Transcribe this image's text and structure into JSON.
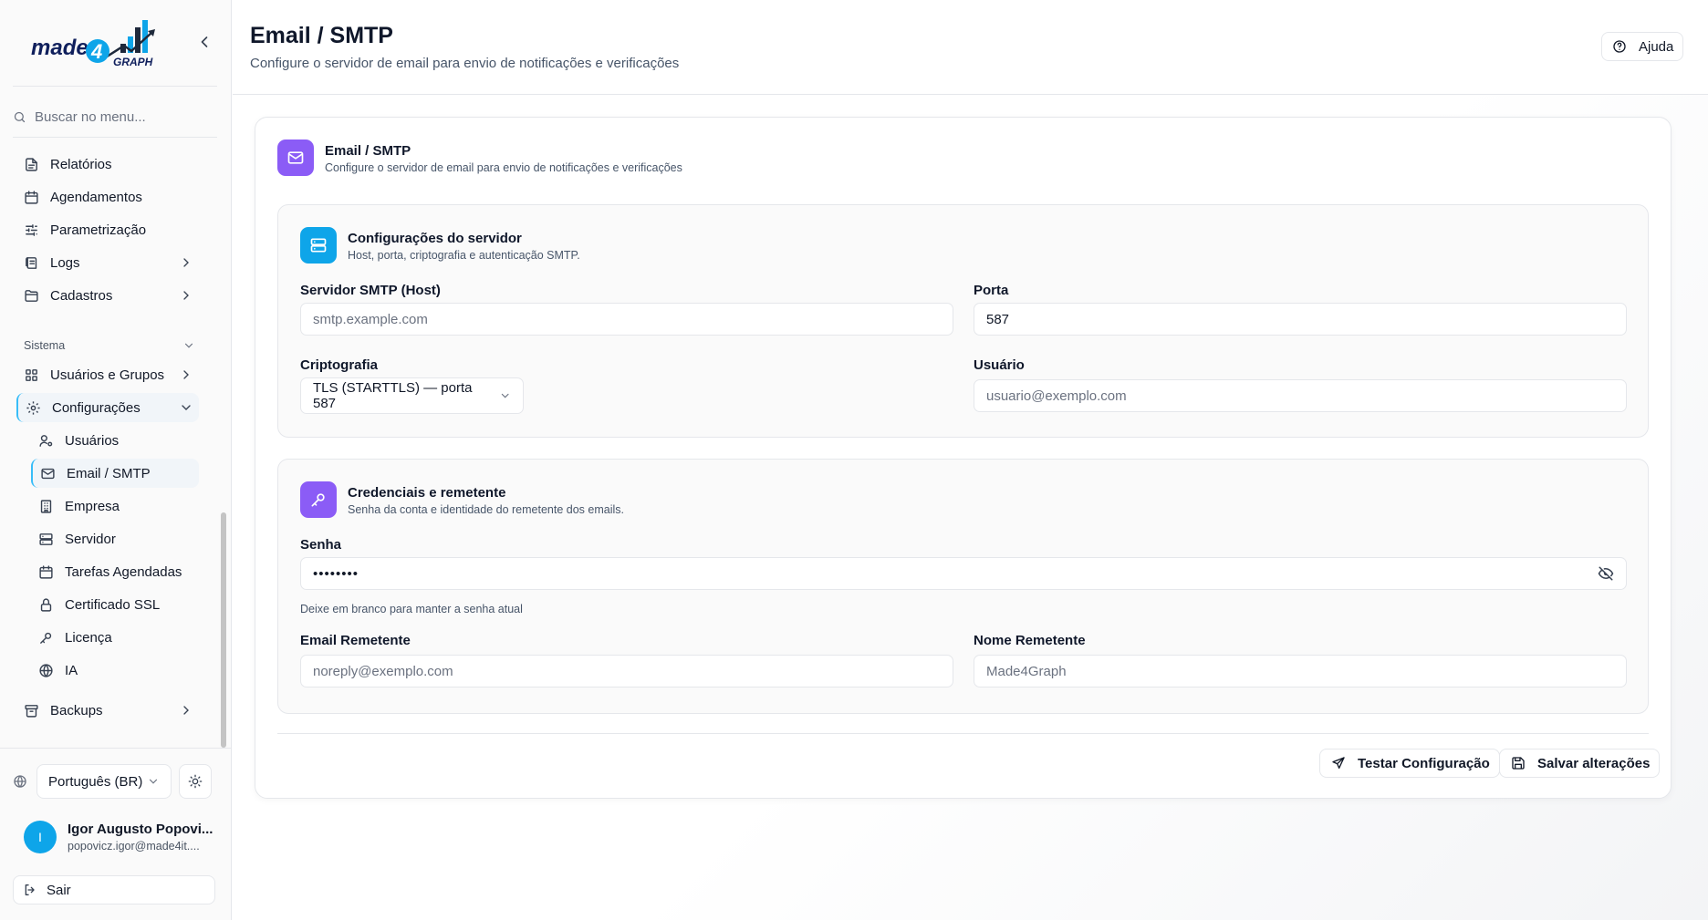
{
  "brand": {
    "logo_text_main": "made",
    "logo_text_num": "4",
    "logo_text_sub": "GRAPH",
    "colors": {
      "accent": "#38bdf8",
      "purple": "#8b5cf6",
      "blue": "#0ea5e9",
      "brand_navy": "#0f1f5c"
    }
  },
  "sidebar": {
    "collapse_icon": "chevron-left-icon",
    "search_placeholder": "Buscar no menu...",
    "items": [
      {
        "label": "Relatórios",
        "icon": "file-text-icon"
      },
      {
        "label": "Agendamentos",
        "icon": "calendar-icon"
      },
      {
        "label": "Parametrização",
        "icon": "sliders-icon"
      },
      {
        "label": "Logs",
        "icon": "logs-icon"
      },
      {
        "label": "Cadastros",
        "icon": "folder-icon"
      }
    ],
    "section_label": "Sistema",
    "system_items": [
      {
        "label": "Usuários e Grupos",
        "icon": "grid-icon"
      },
      {
        "label": "Configurações",
        "icon": "gear-icon"
      }
    ],
    "config_sub": [
      {
        "label": "Usuários",
        "icon": "user-cog-icon"
      },
      {
        "label": "Email / SMTP",
        "icon": "mail-icon"
      },
      {
        "label": "Empresa",
        "icon": "building-icon"
      },
      {
        "label": "Servidor",
        "icon": "server-icon"
      },
      {
        "label": "Tarefas Agendadas",
        "icon": "calendar-icon"
      },
      {
        "label": "Certificado SSL",
        "icon": "lock-icon"
      },
      {
        "label": "Licença",
        "icon": "key-icon"
      },
      {
        "label": "IA",
        "icon": "globe-icon"
      }
    ],
    "backups": {
      "label": "Backups",
      "icon": "archive-icon"
    },
    "language": "Português (BR)",
    "user": {
      "initial": "I",
      "name": "Igor Augusto Popovi...",
      "email": "popovicz.igor@made4it...."
    },
    "logout": "Sair"
  },
  "header": {
    "title": "Email / SMTP",
    "subtitle": "Configure o servidor de email para envio de notificações e verificações",
    "help": "Ajuda"
  },
  "card": {
    "title": "Email / SMTP",
    "subtitle": "Configure o servidor de email para envio de notificações e verificações",
    "server": {
      "title": "Configurações do servidor",
      "subtitle": "Host, porta, criptografia e autenticação SMTP.",
      "host_label": "Servidor SMTP (Host)",
      "host_placeholder": "smtp.example.com",
      "port_label": "Porta",
      "port_value": "587",
      "crypto_label": "Criptografia",
      "crypto_value": "TLS (STARTTLS) — porta 587",
      "user_label": "Usuário",
      "user_placeholder": "usuario@exemplo.com"
    },
    "credentials": {
      "title": "Credenciais e remetente",
      "subtitle": "Senha da conta e identidade do remetente dos emails.",
      "password_label": "Senha",
      "password_value": "••••••••",
      "password_hint": "Deixe em branco para manter a senha atual",
      "sender_email_label": "Email Remetente",
      "sender_email_placeholder": "noreply@exemplo.com",
      "sender_name_label": "Nome Remetente",
      "sender_name_placeholder": "Made4Graph"
    },
    "test_button": "Testar Configuração",
    "save_button": "Salvar alterações"
  }
}
